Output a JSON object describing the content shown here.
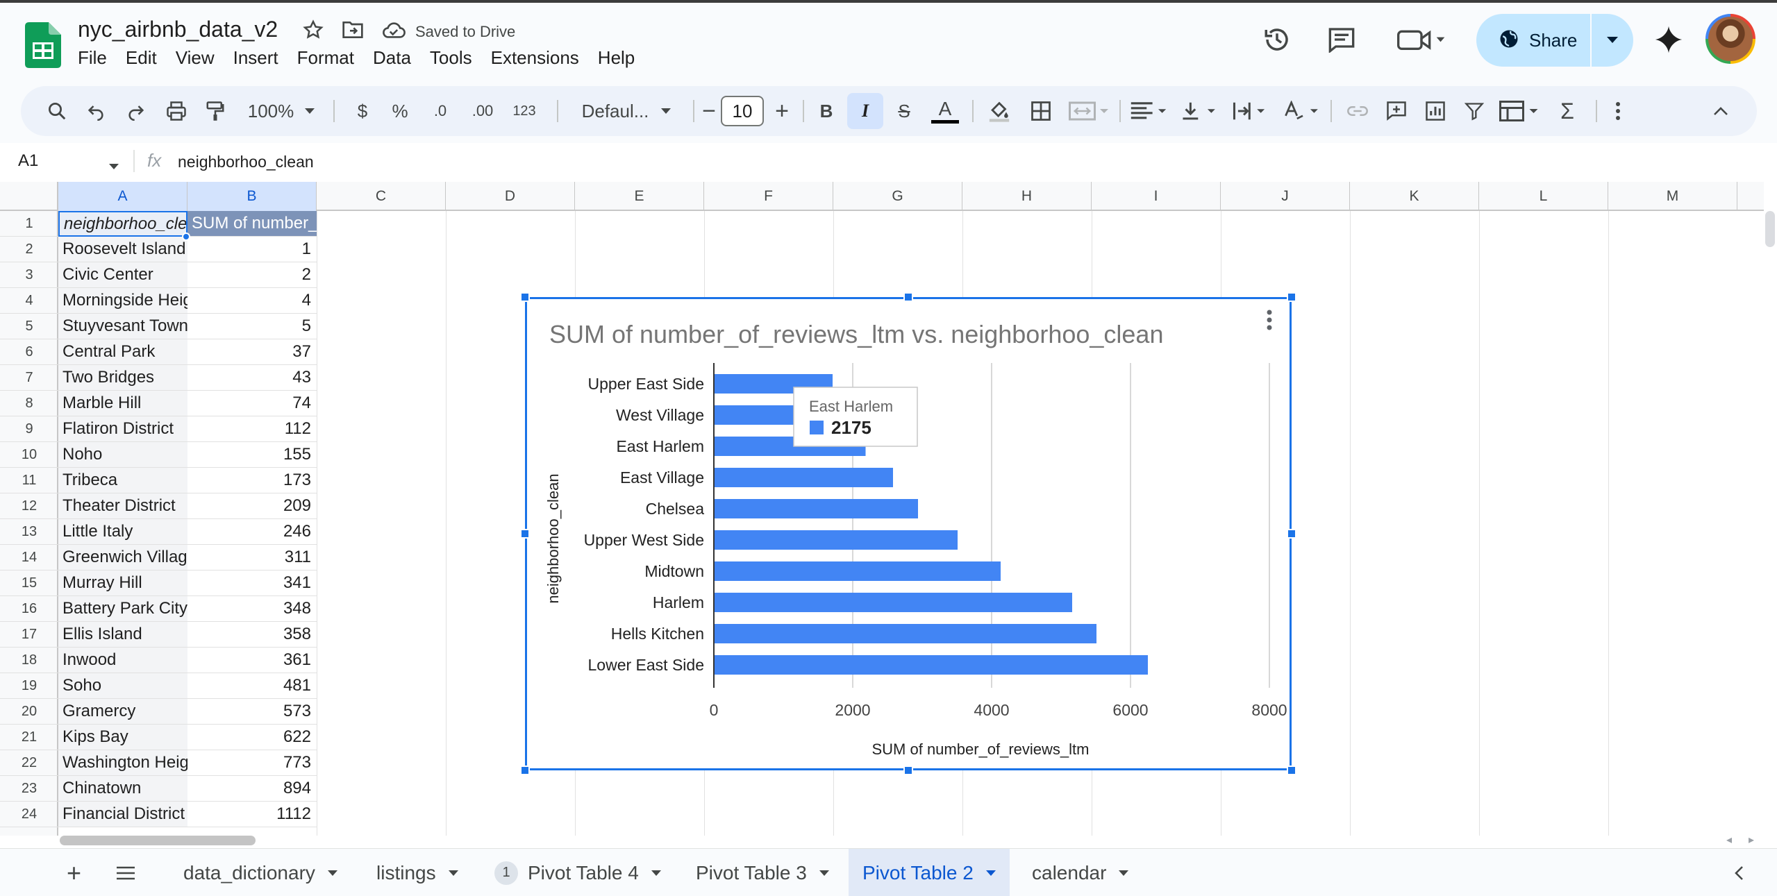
{
  "doc": {
    "title": "nyc_airbnb_data_v2",
    "saved_status": "Saved to Drive"
  },
  "menu": [
    "File",
    "Edit",
    "View",
    "Insert",
    "Format",
    "Data",
    "Tools",
    "Extensions",
    "Help"
  ],
  "share": {
    "label": "Share"
  },
  "toolbar": {
    "zoom": "100%",
    "currency": "$",
    "percent": "%",
    "dec_decrease": ".0",
    "dec_increase": ".00",
    "number_format": "123",
    "font": "Defaul...",
    "font_size": "10",
    "bold": "B",
    "italic": "I",
    "strike": "S",
    "text_color": "A"
  },
  "formula_bar": {
    "cell_ref": "A1",
    "fx": "fx",
    "content": "neighborhoo_clean"
  },
  "columns": [
    "A",
    "B",
    "C",
    "D",
    "E",
    "F",
    "G",
    "H",
    "I",
    "J",
    "K",
    "L",
    "M"
  ],
  "header_row": {
    "a": "neighborhoo_clean",
    "b": "SUM of number_of_reviews_ltm"
  },
  "rows": [
    {
      "n": "1",
      "a": "",
      "b": ""
    },
    {
      "n": "2",
      "a": "Roosevelt Island",
      "b": "1"
    },
    {
      "n": "3",
      "a": "Civic Center",
      "b": "2"
    },
    {
      "n": "4",
      "a": "Morningside Heights",
      "b": "4"
    },
    {
      "n": "5",
      "a": "Stuyvesant Town",
      "b": "5"
    },
    {
      "n": "6",
      "a": "Central Park",
      "b": "37"
    },
    {
      "n": "7",
      "a": "Two Bridges",
      "b": "43"
    },
    {
      "n": "8",
      "a": "Marble Hill",
      "b": "74"
    },
    {
      "n": "9",
      "a": "Flatiron District",
      "b": "112"
    },
    {
      "n": "10",
      "a": "Noho",
      "b": "155"
    },
    {
      "n": "11",
      "a": "Tribeca",
      "b": "173"
    },
    {
      "n": "12",
      "a": "Theater District",
      "b": "209"
    },
    {
      "n": "13",
      "a": "Little Italy",
      "b": "246"
    },
    {
      "n": "14",
      "a": "Greenwich Village",
      "b": "311"
    },
    {
      "n": "15",
      "a": "Murray Hill",
      "b": "341"
    },
    {
      "n": "16",
      "a": "Battery Park City",
      "b": "348"
    },
    {
      "n": "17",
      "a": "Ellis Island",
      "b": "358"
    },
    {
      "n": "18",
      "a": "Inwood",
      "b": "361"
    },
    {
      "n": "19",
      "a": "Soho",
      "b": "481"
    },
    {
      "n": "20",
      "a": "Gramercy",
      "b": "573"
    },
    {
      "n": "21",
      "a": "Kips Bay",
      "b": "622"
    },
    {
      "n": "22",
      "a": "Washington Heights",
      "b": "773"
    },
    {
      "n": "23",
      "a": "Chinatown",
      "b": "894"
    },
    {
      "n": "24",
      "a": "Financial District",
      "b": "1112"
    }
  ],
  "chart_data": {
    "type": "bar",
    "orientation": "horizontal",
    "title": "SUM of number_of_reviews_ltm vs. neighborhoo_clean",
    "xlabel": "SUM of number_of_reviews_ltm",
    "ylabel": "neighborhoo_clean",
    "categories": [
      "Upper East Side",
      "West Village",
      "East Harlem",
      "East Village",
      "Chelsea",
      "Upper West Side",
      "Midtown",
      "Harlem",
      "Hells Kitchen",
      "Lower East Side"
    ],
    "values": [
      1700,
      1900,
      2175,
      2570,
      2930,
      3500,
      4120,
      5150,
      5500,
      6240
    ],
    "xlim": [
      0,
      8000
    ],
    "xticks": [
      "0",
      "2000",
      "4000",
      "6000",
      "8000"
    ],
    "grid": true,
    "bar_color": "#4285f4",
    "tooltip": {
      "category": "East Harlem",
      "value": "2175"
    }
  },
  "sheet_tabs": [
    {
      "label": "data_dictionary",
      "badge": ""
    },
    {
      "label": "listings",
      "badge": ""
    },
    {
      "label": "Pivot Table 4",
      "badge": "1"
    },
    {
      "label": "Pivot Table 3",
      "badge": ""
    },
    {
      "label": "Pivot Table 2",
      "badge": "",
      "active": true
    },
    {
      "label": "calendar",
      "badge": ""
    }
  ],
  "colors": {
    "accent": "#1a73e8",
    "share_bg": "#c2e7ff",
    "sheets_green": "#0f9d58"
  }
}
